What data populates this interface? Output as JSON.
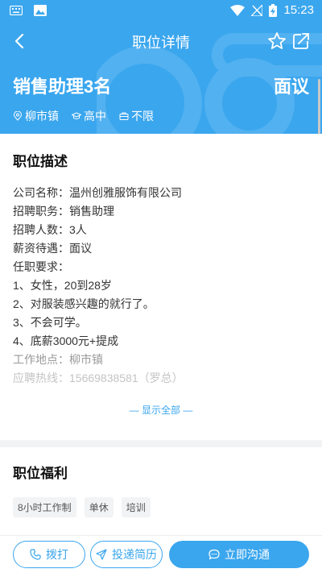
{
  "status_bar": {
    "time": "15:23"
  },
  "nav": {
    "title": "职位详情"
  },
  "job": {
    "title": "销售助理3名",
    "salary": "面议",
    "tags": [
      {
        "icon": "location-icon",
        "label": "柳市镇"
      },
      {
        "icon": "education-icon",
        "label": "高中"
      },
      {
        "icon": "briefcase-icon",
        "label": "不限"
      }
    ]
  },
  "description": {
    "title": "职位描述",
    "lines": [
      "公司名称：温州创雅服饰有限公司",
      "招聘职务：销售助理",
      "招聘人数：3人",
      "薪资待遇：面议",
      "任职要求：",
      "1、女性，20到28岁",
      "2、对服装感兴趣的就行了。",
      "3、不会可学。",
      "4、底薪3000元+提成",
      "工作地点：柳市镇",
      "应聘热线：15669838581（罗总）"
    ],
    "show_all": "— 显示全部 —"
  },
  "benefits": {
    "title": "职位福利",
    "tags": [
      "8小时工作制",
      "单休",
      "培训"
    ]
  },
  "actions": {
    "call": "拨打",
    "resume": "投递简历",
    "chat": "立即沟通"
  },
  "colors": {
    "accent": "#3aa6ee"
  }
}
